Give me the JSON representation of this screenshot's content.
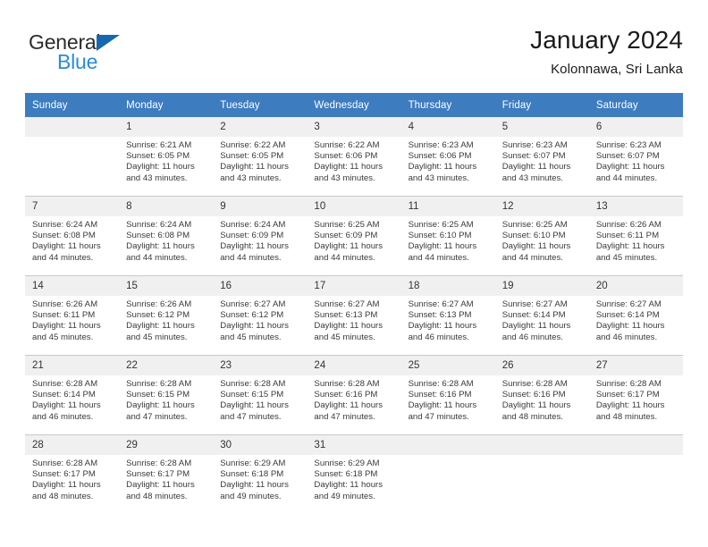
{
  "brand": {
    "name_part1": "General",
    "name_part2": "Blue",
    "triangle_icon": "triangle-icon",
    "accent_color": "#2b8bd8",
    "logo_dark_color": "#2c2c2c",
    "triangle_color": "#1666b0"
  },
  "header": {
    "title": "January 2024",
    "subtitle": "Kolonnawa, Sri Lanka"
  },
  "calendar": {
    "header_bg_color": "#3d7cbf",
    "daynum_bg_color": "#f0f0f0",
    "weekday_headers": [
      "Sunday",
      "Monday",
      "Tuesday",
      "Wednesday",
      "Thursday",
      "Friday",
      "Saturday"
    ],
    "weeks": [
      [
        {
          "day": "",
          "sunrise": "",
          "sunset": "",
          "daylight": "",
          "blank": true
        },
        {
          "day": "1",
          "sunrise": "Sunrise: 6:21 AM",
          "sunset": "Sunset: 6:05 PM",
          "daylight": "Daylight: 11 hours and 43 minutes."
        },
        {
          "day": "2",
          "sunrise": "Sunrise: 6:22 AM",
          "sunset": "Sunset: 6:05 PM",
          "daylight": "Daylight: 11 hours and 43 minutes."
        },
        {
          "day": "3",
          "sunrise": "Sunrise: 6:22 AM",
          "sunset": "Sunset: 6:06 PM",
          "daylight": "Daylight: 11 hours and 43 minutes."
        },
        {
          "day": "4",
          "sunrise": "Sunrise: 6:23 AM",
          "sunset": "Sunset: 6:06 PM",
          "daylight": "Daylight: 11 hours and 43 minutes."
        },
        {
          "day": "5",
          "sunrise": "Sunrise: 6:23 AM",
          "sunset": "Sunset: 6:07 PM",
          "daylight": "Daylight: 11 hours and 43 minutes."
        },
        {
          "day": "6",
          "sunrise": "Sunrise: 6:23 AM",
          "sunset": "Sunset: 6:07 PM",
          "daylight": "Daylight: 11 hours and 44 minutes."
        }
      ],
      [
        {
          "day": "7",
          "sunrise": "Sunrise: 6:24 AM",
          "sunset": "Sunset: 6:08 PM",
          "daylight": "Daylight: 11 hours and 44 minutes."
        },
        {
          "day": "8",
          "sunrise": "Sunrise: 6:24 AM",
          "sunset": "Sunset: 6:08 PM",
          "daylight": "Daylight: 11 hours and 44 minutes."
        },
        {
          "day": "9",
          "sunrise": "Sunrise: 6:24 AM",
          "sunset": "Sunset: 6:09 PM",
          "daylight": "Daylight: 11 hours and 44 minutes."
        },
        {
          "day": "10",
          "sunrise": "Sunrise: 6:25 AM",
          "sunset": "Sunset: 6:09 PM",
          "daylight": "Daylight: 11 hours and 44 minutes."
        },
        {
          "day": "11",
          "sunrise": "Sunrise: 6:25 AM",
          "sunset": "Sunset: 6:10 PM",
          "daylight": "Daylight: 11 hours and 44 minutes."
        },
        {
          "day": "12",
          "sunrise": "Sunrise: 6:25 AM",
          "sunset": "Sunset: 6:10 PM",
          "daylight": "Daylight: 11 hours and 44 minutes."
        },
        {
          "day": "13",
          "sunrise": "Sunrise: 6:26 AM",
          "sunset": "Sunset: 6:11 PM",
          "daylight": "Daylight: 11 hours and 45 minutes."
        }
      ],
      [
        {
          "day": "14",
          "sunrise": "Sunrise: 6:26 AM",
          "sunset": "Sunset: 6:11 PM",
          "daylight": "Daylight: 11 hours and 45 minutes."
        },
        {
          "day": "15",
          "sunrise": "Sunrise: 6:26 AM",
          "sunset": "Sunset: 6:12 PM",
          "daylight": "Daylight: 11 hours and 45 minutes."
        },
        {
          "day": "16",
          "sunrise": "Sunrise: 6:27 AM",
          "sunset": "Sunset: 6:12 PM",
          "daylight": "Daylight: 11 hours and 45 minutes."
        },
        {
          "day": "17",
          "sunrise": "Sunrise: 6:27 AM",
          "sunset": "Sunset: 6:13 PM",
          "daylight": "Daylight: 11 hours and 45 minutes."
        },
        {
          "day": "18",
          "sunrise": "Sunrise: 6:27 AM",
          "sunset": "Sunset: 6:13 PM",
          "daylight": "Daylight: 11 hours and 46 minutes."
        },
        {
          "day": "19",
          "sunrise": "Sunrise: 6:27 AM",
          "sunset": "Sunset: 6:14 PM",
          "daylight": "Daylight: 11 hours and 46 minutes."
        },
        {
          "day": "20",
          "sunrise": "Sunrise: 6:27 AM",
          "sunset": "Sunset: 6:14 PM",
          "daylight": "Daylight: 11 hours and 46 minutes."
        }
      ],
      [
        {
          "day": "21",
          "sunrise": "Sunrise: 6:28 AM",
          "sunset": "Sunset: 6:14 PM",
          "daylight": "Daylight: 11 hours and 46 minutes."
        },
        {
          "day": "22",
          "sunrise": "Sunrise: 6:28 AM",
          "sunset": "Sunset: 6:15 PM",
          "daylight": "Daylight: 11 hours and 47 minutes."
        },
        {
          "day": "23",
          "sunrise": "Sunrise: 6:28 AM",
          "sunset": "Sunset: 6:15 PM",
          "daylight": "Daylight: 11 hours and 47 minutes."
        },
        {
          "day": "24",
          "sunrise": "Sunrise: 6:28 AM",
          "sunset": "Sunset: 6:16 PM",
          "daylight": "Daylight: 11 hours and 47 minutes."
        },
        {
          "day": "25",
          "sunrise": "Sunrise: 6:28 AM",
          "sunset": "Sunset: 6:16 PM",
          "daylight": "Daylight: 11 hours and 47 minutes."
        },
        {
          "day": "26",
          "sunrise": "Sunrise: 6:28 AM",
          "sunset": "Sunset: 6:16 PM",
          "daylight": "Daylight: 11 hours and 48 minutes."
        },
        {
          "day": "27",
          "sunrise": "Sunrise: 6:28 AM",
          "sunset": "Sunset: 6:17 PM",
          "daylight": "Daylight: 11 hours and 48 minutes."
        }
      ],
      [
        {
          "day": "28",
          "sunrise": "Sunrise: 6:28 AM",
          "sunset": "Sunset: 6:17 PM",
          "daylight": "Daylight: 11 hours and 48 minutes."
        },
        {
          "day": "29",
          "sunrise": "Sunrise: 6:28 AM",
          "sunset": "Sunset: 6:17 PM",
          "daylight": "Daylight: 11 hours and 48 minutes."
        },
        {
          "day": "30",
          "sunrise": "Sunrise: 6:29 AM",
          "sunset": "Sunset: 6:18 PM",
          "daylight": "Daylight: 11 hours and 49 minutes."
        },
        {
          "day": "31",
          "sunrise": "Sunrise: 6:29 AM",
          "sunset": "Sunset: 6:18 PM",
          "daylight": "Daylight: 11 hours and 49 minutes."
        },
        {
          "day": "",
          "sunrise": "",
          "sunset": "",
          "daylight": "",
          "blank": true
        },
        {
          "day": "",
          "sunrise": "",
          "sunset": "",
          "daylight": "",
          "blank": true
        },
        {
          "day": "",
          "sunrise": "",
          "sunset": "",
          "daylight": "",
          "blank": true
        }
      ]
    ]
  }
}
